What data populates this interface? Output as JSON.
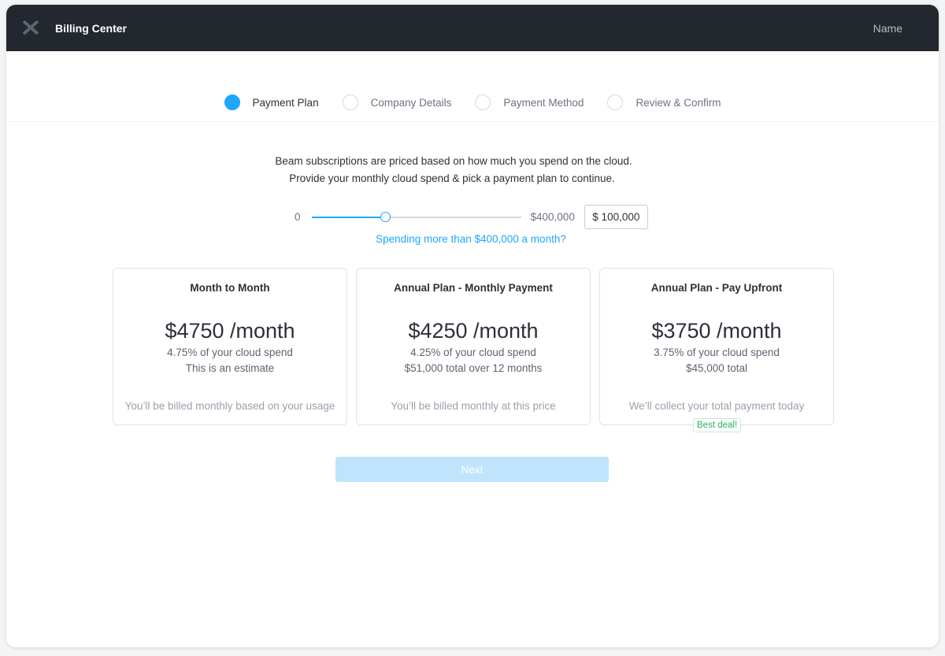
{
  "header": {
    "title": "Billing Center",
    "user": "Name"
  },
  "steps": [
    {
      "label": "Payment Plan",
      "active": true
    },
    {
      "label": "Company Details",
      "active": false
    },
    {
      "label": "Payment Method",
      "active": false
    },
    {
      "label": "Review & Confirm",
      "active": false
    }
  ],
  "intro": {
    "line1": "Beam subscriptions are priced based on how much you spend on the cloud.",
    "line2": "Provide your monthly cloud spend & pick a payment plan to continue."
  },
  "slider": {
    "min_label": "0",
    "max_label": "$400,000",
    "value": 100000,
    "max": 400000,
    "value_display": "$ 100,000",
    "link": "Spending more than $400,000 a month?"
  },
  "plans": [
    {
      "title": "Month to Month",
      "price": "$4750 /month",
      "line1": "4.75% of your cloud spend",
      "line2": "This is an estimate",
      "note": "You’ll be billed monthly based on your usage"
    },
    {
      "title": "Annual Plan - Monthly Payment",
      "price": "$4250 /month",
      "line1": "4.25% of your cloud spend",
      "line2": "$51,000 total over 12 months",
      "note": "You’ll be billed monthly at this price"
    },
    {
      "title": "Annual Plan - Pay Upfront",
      "price": "$3750 /month",
      "line1": "3.75% of your cloud spend",
      "line2": "$45,000 total",
      "note": "We’ll collect your total payment today",
      "badge": "Best deal!"
    }
  ],
  "next_label": "Next",
  "colors": {
    "accent": "#1ea7fd",
    "header": "#23272e",
    "badge": "#27b15a"
  }
}
